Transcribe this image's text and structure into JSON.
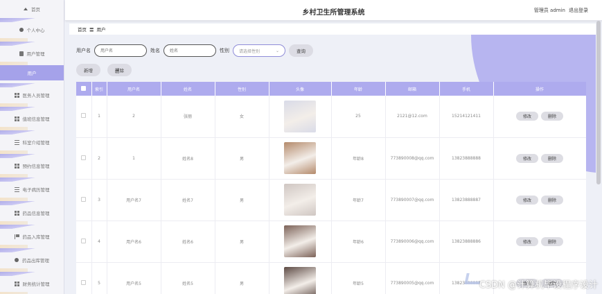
{
  "header": {
    "title": "乡村卫生所管理系统",
    "user_label": "管理员 admin",
    "logout_label": "退出登录"
  },
  "sidebar": {
    "items": [
      {
        "label": "首页",
        "icon": "home-icon"
      },
      {
        "label": "个人中心",
        "icon": "user-icon"
      },
      {
        "label": "用户管理",
        "icon": "bag-icon"
      },
      {
        "label": "用户",
        "icon": ""
      },
      {
        "label": "医务人员管理",
        "icon": "grid-icon"
      },
      {
        "label": "值班信息管理",
        "icon": "grid-icon"
      },
      {
        "label": "科室介绍管理",
        "icon": "list-icon"
      },
      {
        "label": "预约信息管理",
        "icon": "grid-icon"
      },
      {
        "label": "电子病历管理",
        "icon": "list-icon"
      },
      {
        "label": "药品信息管理",
        "icon": "grid-icon"
      },
      {
        "label": "药品入库管理",
        "icon": "flag-icon"
      },
      {
        "label": "药品出库管理",
        "icon": "user-icon"
      },
      {
        "label": "财务统计管理",
        "icon": "grid-icon"
      }
    ]
  },
  "breadcrumb": {
    "home": "首页",
    "sep": "〓",
    "current": "用户"
  },
  "filters": {
    "username_label": "用户名",
    "username_placeholder": "用户名",
    "name_label": "姓名",
    "name_placeholder": "姓名",
    "gender_label": "性别",
    "gender_placeholder": "请选择性别",
    "query_button": "查询"
  },
  "actions": {
    "add": "新增",
    "delete": "删除"
  },
  "table": {
    "headers": [
      "",
      "索引",
      "用户名",
      "姓名",
      "性别",
      "头像",
      "年龄",
      "邮箱",
      "手机",
      "操作"
    ],
    "rows": [
      {
        "index": "1",
        "username": "2",
        "name": "张丽",
        "gender": "女",
        "age": "25",
        "email": "2121@12.com",
        "phone": "15214121411",
        "photo_color": "#d9dbe8"
      },
      {
        "index": "2",
        "username": "1",
        "name": "姓名8",
        "gender": "男",
        "age": "年龄8",
        "email": "773890008@qq.com",
        "phone": "13823888888",
        "photo_color": "#b48a6b"
      },
      {
        "index": "3",
        "username": "用户名7",
        "name": "姓名7",
        "gender": "男",
        "age": "年龄7",
        "email": "773890007@qq.com",
        "phone": "13823888887",
        "photo_color": "#cfc6c2"
      },
      {
        "index": "4",
        "username": "用户名6",
        "name": "姓名6",
        "gender": "男",
        "age": "年龄6",
        "email": "773890006@qq.com",
        "phone": "13823888886",
        "photo_color": "#7c6258"
      },
      {
        "index": "5",
        "username": "用户名5",
        "name": "姓名5",
        "gender": "男",
        "age": "年龄5",
        "email": "773890005@qq.com",
        "phone": "13823888885",
        "photo_color": "#5d4a44"
      }
    ],
    "edit_label": "修改",
    "delete_label": "删除"
  },
  "watermark": "CSDN @计算机毕设程序设计",
  "colors": {
    "accent": "#aeabee",
    "sidebar_active": "#a5a2ea"
  }
}
